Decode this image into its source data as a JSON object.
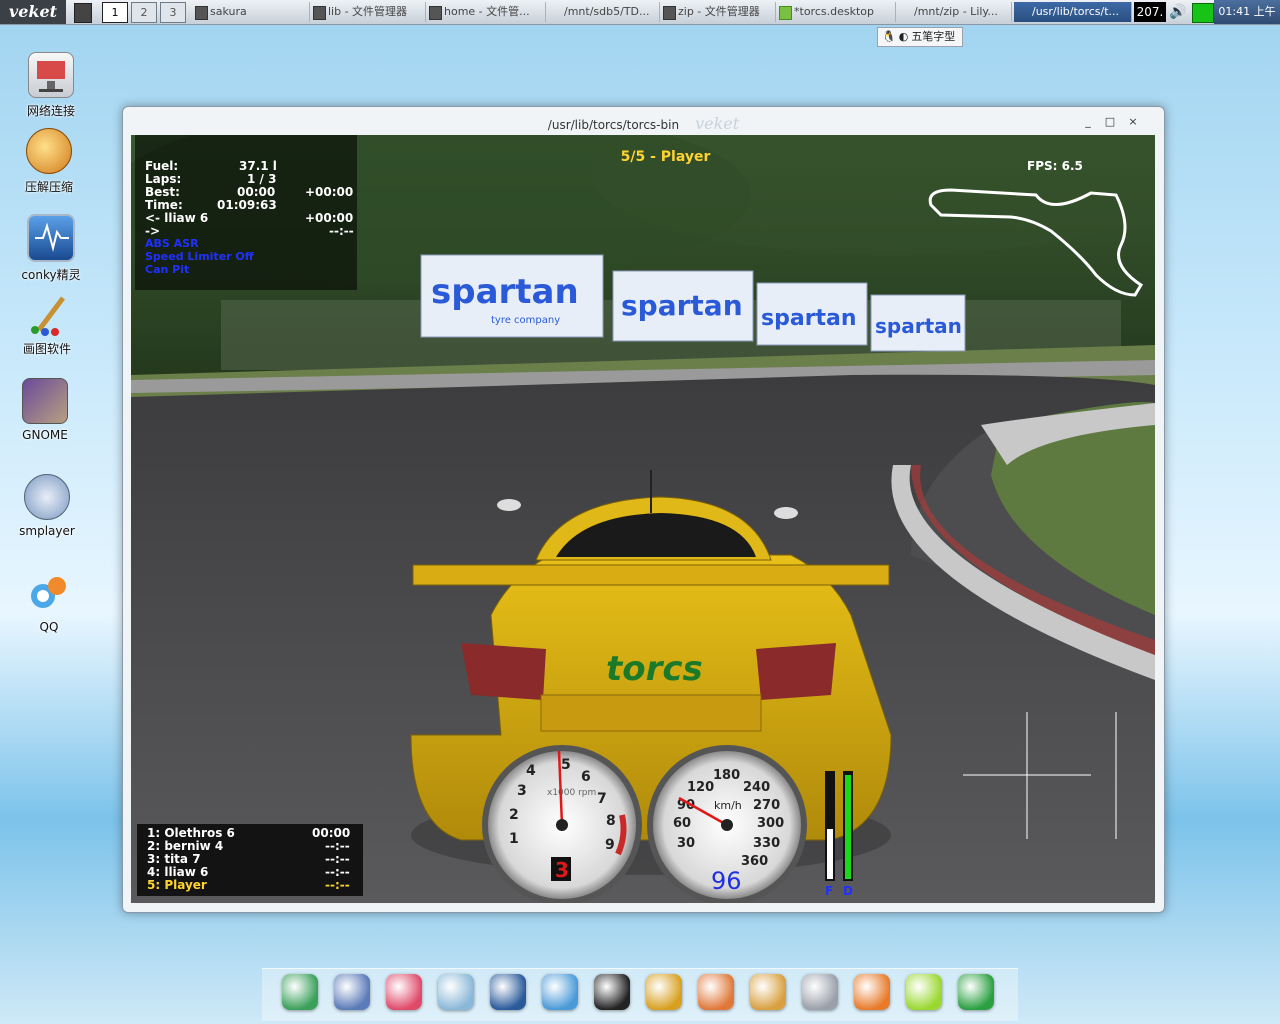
{
  "taskbar": {
    "logo": "veket",
    "workspaces": [
      "1",
      "2",
      "3"
    ],
    "tasks": [
      {
        "label": "sakura",
        "active": false
      },
      {
        "label": "lib - 文件管理器",
        "active": false
      },
      {
        "label": "home - 文件管...",
        "active": false
      },
      {
        "label": "/mnt/sdb5/TD...",
        "active": false
      },
      {
        "label": "zip - 文件管理器",
        "active": false
      },
      {
        "label": "*torcs.desktop",
        "active": false
      },
      {
        "label": "/mnt/zip - Lily...",
        "active": false
      },
      {
        "label": "/usr/lib/torcs/t...",
        "active": true
      }
    ],
    "tray_value": "207.",
    "clock": "01:41 上午"
  },
  "ime": {
    "items": [
      "五笔字型"
    ]
  },
  "desktop_icons": [
    {
      "label": "网络连接",
      "icon": "network-icon",
      "color": "#d84a4a"
    },
    {
      "label": "压解压缩",
      "icon": "archive-icon",
      "color": "#e08a2a"
    },
    {
      "label": "conky精灵",
      "icon": "monitor-icon",
      "color": "#2a78c8"
    },
    {
      "label": "画图软件",
      "icon": "paint-icon",
      "color": "#c89030"
    },
    {
      "label": "GNOME",
      "icon": "gnome-icon",
      "color": "#6a4a9a"
    },
    {
      "label": "smplayer",
      "icon": "player-icon",
      "color": "#3a88c8"
    },
    {
      "label": "QQ",
      "icon": "qq-icon",
      "color": "#3aa0e0"
    }
  ],
  "window": {
    "title": "/usr/lib/torcs/torcs-bin",
    "brand": "veket",
    "controls": [
      "_",
      "□",
      "×"
    ]
  },
  "hud": {
    "position_title": "5/5 - Player",
    "rows": [
      {
        "label": "Fuel:",
        "value": "37.1 l",
        "delta": ""
      },
      {
        "label": "Laps:",
        "value": "1 / 3",
        "delta": ""
      },
      {
        "label": "Best:",
        "value": "00:00",
        "delta": "+00:00"
      },
      {
        "label": "Time:",
        "value": "01:09:63",
        "delta": ""
      },
      {
        "label": "<- lliaw 6",
        "value": "",
        "delta": "+00:00"
      },
      {
        "label": "->",
        "value": "",
        "delta": "--:--"
      }
    ],
    "blue_lines": [
      "ABS ASR",
      "Speed Limiter Off",
      "Can Pit"
    ],
    "fps": "FPS: 6.5",
    "leaderboard": [
      {
        "label": "1: Olethros 6",
        "value": "00:00"
      },
      {
        "label": "2: berniw 4",
        "value": "--:--"
      },
      {
        "label": "3: tita 7",
        "value": "--:--"
      },
      {
        "label": "4: lliaw 6",
        "value": "--:--"
      },
      {
        "label": "5: Player",
        "value": "--:--"
      }
    ]
  },
  "gauges": {
    "gear": "3",
    "speed": "96",
    "rpm_unit": "x1000 rpm",
    "speed_unit": "km/h",
    "rpm_ticks": [
      "1",
      "2",
      "3",
      "4",
      "5",
      "6",
      "7",
      "8",
      "9"
    ],
    "speed_ticks": [
      "30",
      "60",
      "90",
      "120",
      "180",
      "240",
      "270",
      "300",
      "330",
      "360"
    ],
    "fuel_bar_label": "F",
    "damage_bar_label": "D"
  },
  "scene": {
    "billboard_text": "spartan",
    "billboard_sub": "tyre company",
    "car_logo": "torcs"
  },
  "dock": {
    "icons": [
      "hardinfo-icon",
      "computer-icon",
      "pet-icon",
      "notepad-icon",
      "media-icon",
      "network-users-icon",
      "qq-penguin-icon",
      "door-exit-icon",
      "windows-icon",
      "paint-palette-icon",
      "usb-drive-icon",
      "photo-icon",
      "help-icon",
      "camera-icon"
    ]
  }
}
